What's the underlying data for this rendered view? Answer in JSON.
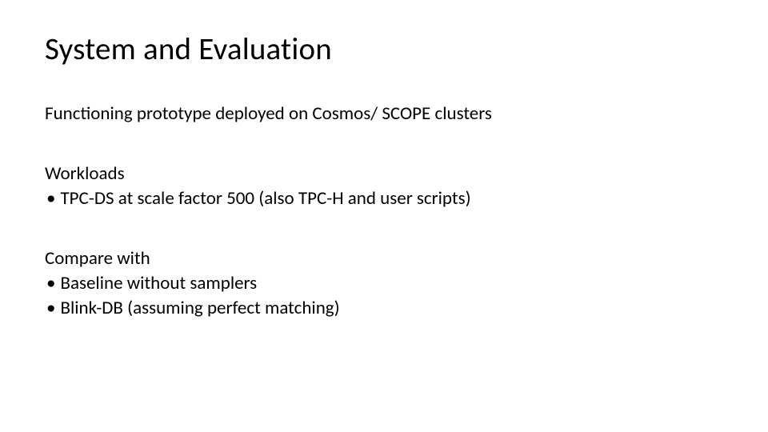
{
  "title": "System and Evaluation",
  "intro": "Functioning prototype deployed on Cosmos/ SCOPE clusters",
  "workloads": {
    "heading": "Workloads",
    "items": [
      "TPC-DS at scale factor 500 (also TPC-H and user scripts)"
    ]
  },
  "compare": {
    "heading": "Compare with",
    "items": [
      "Baseline without samplers",
      "Blink-DB (assuming perfect matching)"
    ]
  }
}
